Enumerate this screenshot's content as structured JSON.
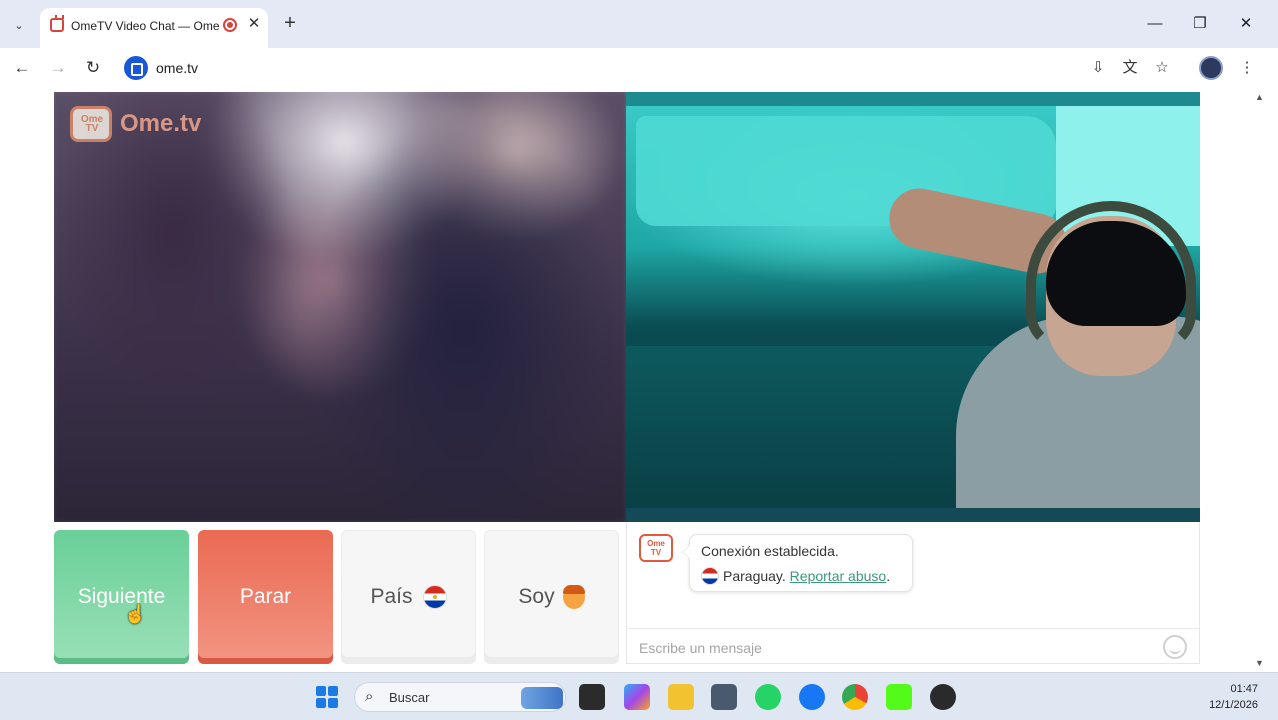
{
  "browser": {
    "tab_title": "OmeTV Video Chat — Ome",
    "url": "ome.tv",
    "window_buttons": {
      "minimize": "—",
      "restore": "❐",
      "close": "✕"
    },
    "new_tab": "+"
  },
  "remote": {
    "logo_text": "Ome.tv",
    "logo_badge": "Ome TV"
  },
  "controls": {
    "next_label": "Siguiente",
    "stop_label": "Parar",
    "country_label": "País",
    "gender_label": "Soy"
  },
  "chat": {
    "badge": "Ome TV",
    "status": "Conexión establecida.",
    "country": "Paraguay.",
    "report_link": "Reportar abuso",
    "report_suffix": ".",
    "input_placeholder": "Escribe un mensaje"
  },
  "taskbar": {
    "search_label": "Buscar",
    "time": "01:47",
    "date": "12/1/2026"
  },
  "colors": {
    "next": "#69cf97",
    "stop": "#ea6a52",
    "link": "#3b9a78",
    "accent": "#1a57d6"
  }
}
